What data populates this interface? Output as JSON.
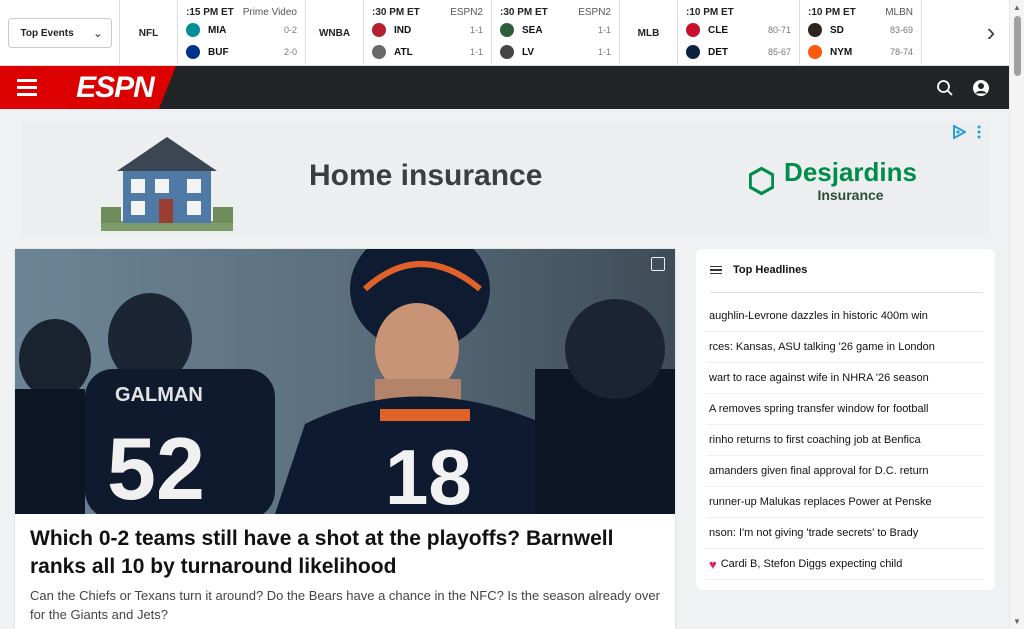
{
  "scoreboard": {
    "events_dropdown": "Top Events",
    "leagues": [
      {
        "label": "NFL"
      },
      {
        "label": "WNBA"
      },
      {
        "label": "MLB"
      }
    ],
    "games": [
      {
        "time": ":15 PM ET",
        "network": "Prime Video",
        "teams": [
          {
            "abbr": "MIA",
            "record": "0-2",
            "color": "#008e97"
          },
          {
            "abbr": "BUF",
            "record": "2-0",
            "color": "#00338d"
          }
        ]
      },
      {
        "time": ":30 PM ET",
        "network": "ESPN2",
        "teams": [
          {
            "abbr": "IND",
            "record": "1-1",
            "color": "#b4202f"
          },
          {
            "abbr": "ATL",
            "record": "1-1",
            "color": "#6a6a6a"
          }
        ]
      },
      {
        "time": ":30 PM ET",
        "network": "ESPN2",
        "teams": [
          {
            "abbr": "SEA",
            "record": "1-1",
            "color": "#2c5e3a"
          },
          {
            "abbr": "LV",
            "record": "1-1",
            "color": "#444444"
          }
        ]
      },
      {
        "time": ":10 PM ET",
        "network": "",
        "teams": [
          {
            "abbr": "CLE",
            "record": "80-71",
            "color": "#c8102e"
          },
          {
            "abbr": "DET",
            "record": "85-67",
            "color": "#0c2340"
          }
        ]
      },
      {
        "time": ":10 PM ET",
        "network": "MLBN",
        "teams": [
          {
            "abbr": "SD",
            "record": "83-69",
            "color": "#2f241d"
          },
          {
            "abbr": "NYM",
            "record": "78-74",
            "color": "#ff5910"
          }
        ]
      }
    ]
  },
  "nav": {
    "logo_text": "ESPN"
  },
  "ad": {
    "headline": "Home insurance",
    "brand_name": "Desjardins",
    "brand_sub": "Insurance"
  },
  "hero": {
    "title": "Which 0-2 teams still have a shot at the playoffs? Barnwell ranks all 10 by turnaround likelihood",
    "description": "Can the Chiefs or Texans turn it around? Do the Bears have a chance in the NFC? Is the season already over for the Giants and Jets?",
    "jersey_number": "18",
    "back_number": "52",
    "back_name": "GALMAN"
  },
  "headlines": {
    "title": "Top Headlines",
    "items": [
      "aughlin-Levrone dazzles in historic 400m win",
      "rces: Kansas, ASU talking '26 game in London",
      "wart to race against wife in NHRA '26 season",
      "A removes spring transfer window for football",
      "rinho returns to first coaching job at Benfica",
      "amanders given final approval for D.C. return",
      "runner-up Malukas replaces Power at Penske",
      "nson: I'm not giving 'trade secrets' to Brady",
      "Cardi B, Stefon Diggs expecting child"
    ]
  }
}
